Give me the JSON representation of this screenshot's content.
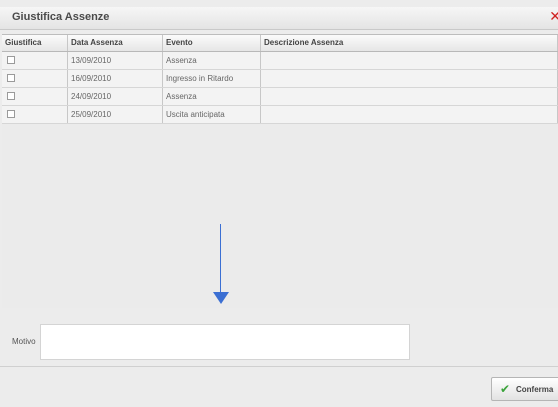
{
  "dialog": {
    "title": "Giustifica Assenze"
  },
  "table": {
    "headers": [
      "Giustifica",
      "Data Assenza",
      "Evento",
      "Descrizione Assenza"
    ],
    "rows": [
      {
        "date": "13/09/2010",
        "event": "Assenza",
        "description": ""
      },
      {
        "date": "16/09/2010",
        "event": "Ingresso in Ritardo",
        "description": ""
      },
      {
        "date": "24/09/2010",
        "event": "Assenza",
        "description": ""
      },
      {
        "date": "25/09/2010",
        "event": "Uscita anticipata",
        "description": ""
      }
    ]
  },
  "form": {
    "motivo_label": "Motivo",
    "motivo_value": ""
  },
  "actions": {
    "confirm_label": "Conferma"
  },
  "colors": {
    "arrow": "#3b6fd3",
    "close": "#d02020",
    "confirm_check": "#3aa33a"
  }
}
